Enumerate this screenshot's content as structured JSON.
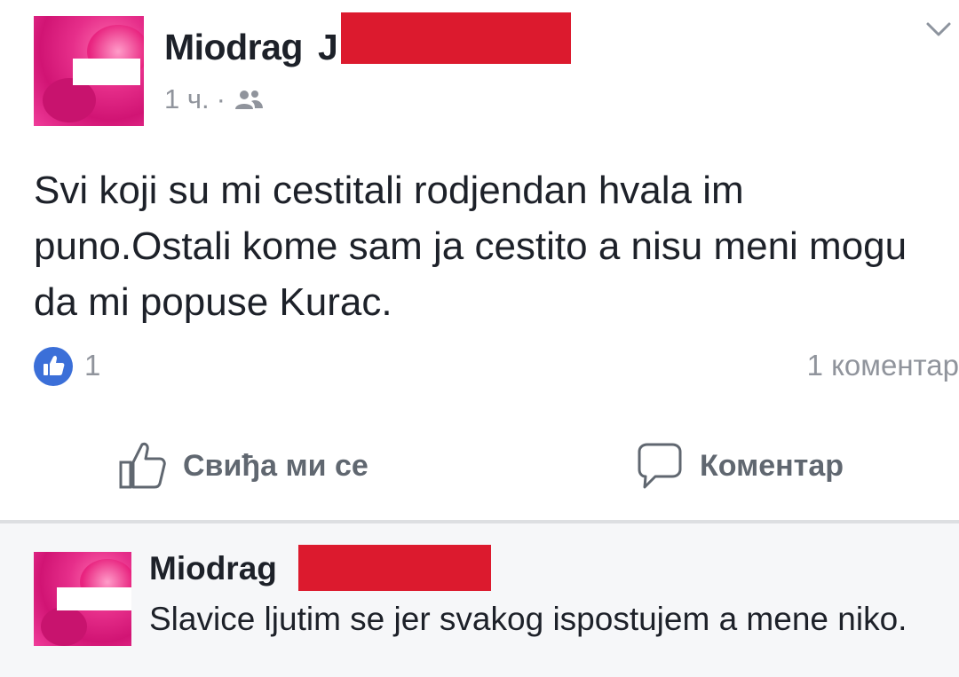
{
  "post": {
    "author_first_name": "Miodrag",
    "author_name_tail": "J",
    "time": "1 ч.",
    "separator": "·",
    "audience_icon": "friends-icon",
    "menu_icon": "chevron-down-icon",
    "text": "Svi koji su mi cestitali rodjendan hvala im puno.Ostali kome sam ja cestito a nisu meni mogu da mi popuse Kurac.",
    "reactions": {
      "icon": "like-reaction-icon",
      "count": "1",
      "color": "#3b6fd8"
    },
    "comment_count": "1 коментар"
  },
  "actions": {
    "like_label": "Свиђа ми се",
    "like_icon": "thumbs-up-icon",
    "comment_label": "Коментар",
    "comment_icon": "speech-bubble-icon"
  },
  "comment": {
    "author_first_name": "Miodrag",
    "text": "Slavice ljutim se jer svakog ispostujem a mene niko."
  },
  "colors": {
    "redaction": "#dc1a2e",
    "comment_background": "#f6f7f9",
    "muted_text": "#90949c",
    "action_text": "#606770"
  }
}
